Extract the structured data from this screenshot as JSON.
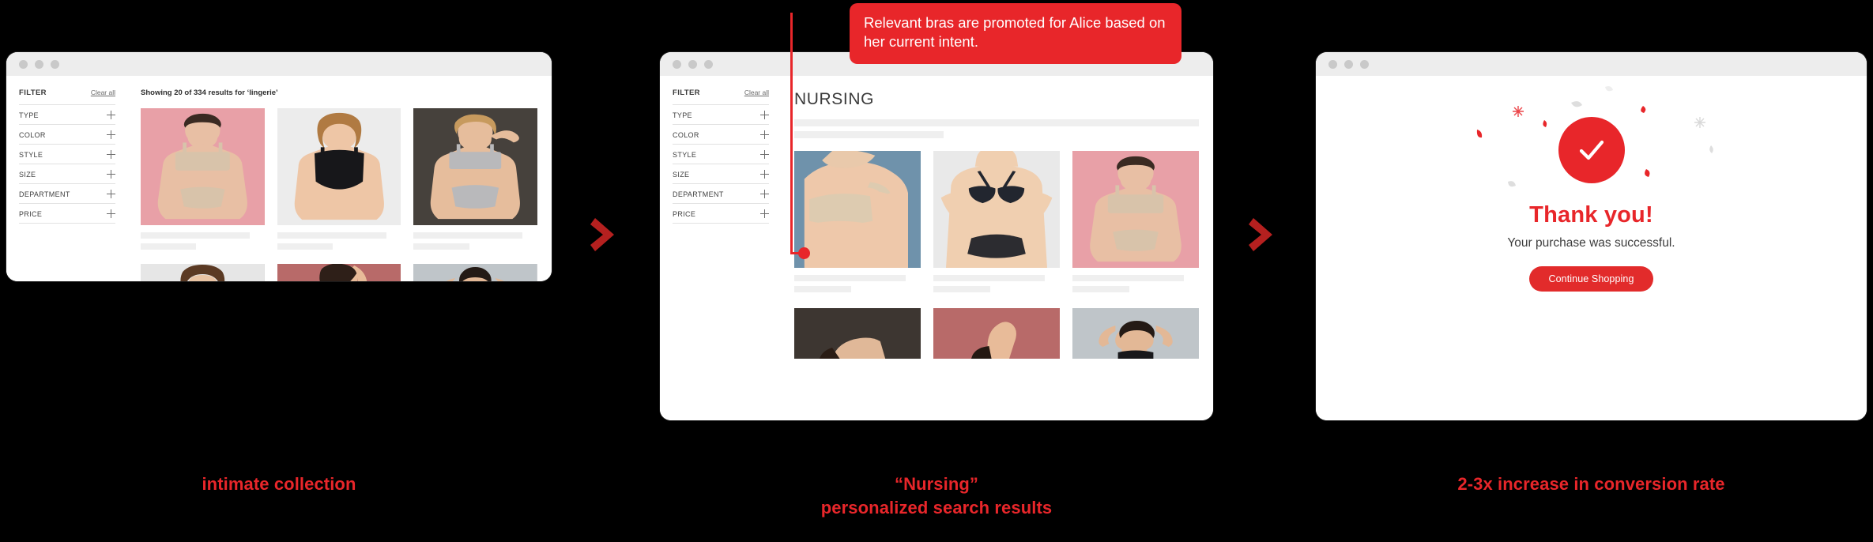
{
  "colors": {
    "accent_red": "#e8262a",
    "arrow_red": "#b5201f",
    "background": "#000000",
    "skeleton_gray": "#efefef",
    "titlebar_gray": "#ededed"
  },
  "callout": {
    "text": "Relevant bras are promoted for Alice based on her current intent."
  },
  "window_search": {
    "traffic_lights": [
      "close-dot",
      "minimize-dot",
      "maximize-dot"
    ],
    "sidebar": {
      "title": "FILTER",
      "clear_all": "Clear all",
      "facets": [
        {
          "label": "TYPE",
          "expander": "plus-icon"
        },
        {
          "label": "COLOR",
          "expander": "plus-icon"
        },
        {
          "label": "STYLE",
          "expander": "plus-icon"
        },
        {
          "label": "SIZE",
          "expander": "plus-icon"
        },
        {
          "label": "DEPARTMENT",
          "expander": "plus-icon"
        },
        {
          "label": "PRICE",
          "expander": "plus-icon"
        }
      ]
    },
    "results_count": "Showing 20 of 334 results for ‘lingerie’",
    "products_row1": [
      {
        "name": "product-pink-nude-set",
        "bg": "#e8a0a7",
        "skin": "#e8bfa4",
        "garment": "#d8c3aa",
        "hair": "#3a2a22"
      },
      {
        "name": "product-black-bodysuit",
        "bg": "#ececec",
        "skin": "#eec6a6",
        "garment": "#17171a",
        "hair": "#b07a42"
      },
      {
        "name": "product-gray-set",
        "bg": "#46413c",
        "skin": "#e6bd9c",
        "garment": "#b9b9bb",
        "hair": "#c79a5e"
      }
    ],
    "products_row2": [
      {
        "name": "product-white-black-dress",
        "bg": "#e6e6e6",
        "skin": "#eac4a4",
        "garment": "#1b1b1e",
        "hair": "#5b3a24"
      },
      {
        "name": "product-rose-bralette",
        "bg": "#b86a69",
        "skin": "#e8bb99",
        "garment": "#e6e0d4",
        "hair": "#2e1f18"
      },
      {
        "name": "product-gray-camisole",
        "bg": "#bfc5c9",
        "skin": "#e3b896",
        "garment": "#18181b",
        "hair": "#241a15"
      }
    ]
  },
  "window_category": {
    "traffic_lights": [
      "close-dot",
      "minimize-dot",
      "maximize-dot"
    ],
    "sidebar": {
      "title": "FILTER",
      "clear_all": "Clear all",
      "facets": [
        {
          "label": "TYPE",
          "expander": "plus-icon"
        },
        {
          "label": "COLOR",
          "expander": "plus-icon"
        },
        {
          "label": "STYLE",
          "expander": "plus-icon"
        },
        {
          "label": "SIZE",
          "expander": "plus-icon"
        },
        {
          "label": "DEPARTMENT",
          "expander": "plus-icon"
        },
        {
          "label": "PRICE",
          "expander": "plus-icon"
        }
      ]
    },
    "category_title": "NURSING",
    "products_row1": [
      {
        "name": "product-nursing-bra-blue",
        "bg": "#6f92ab",
        "skin": "#eec8aa",
        "garment": "#ddcbb0",
        "hair": "#e9c9ab"
      },
      {
        "name": "product-navy-lace-bra",
        "bg": "#e9e9e9",
        "skin": "#f0cfb0",
        "garment": "#22262f",
        "hair": "#e9cfb3"
      },
      {
        "name": "product-nude-set-pink-bg",
        "bg": "#e8a0a7",
        "skin": "#e8bfa4",
        "garment": "#d8c3aa",
        "hair": "#3a2a22"
      }
    ],
    "products_row2": [
      {
        "name": "product-dark-bg-model",
        "bg": "#3d3631",
        "skin": "#e0b898",
        "garment": "#2a2422",
        "hair": "#2a1c14"
      },
      {
        "name": "product-rose-bg-model",
        "bg": "#b86a69",
        "skin": "#e8bb99",
        "garment": "#1e1a18",
        "hair": "#241812"
      },
      {
        "name": "product-gray-bg-model",
        "bg": "#bfc5c9",
        "skin": "#e3b896",
        "garment": "#18181b",
        "hair": "#241a15"
      }
    ]
  },
  "window_thanks": {
    "traffic_lights": [
      "close-dot",
      "minimize-dot",
      "maximize-dot"
    ],
    "check_icon": "checkmark-icon",
    "title": "Thank you!",
    "subtitle": "Your purchase was successful.",
    "button_label": "Continue Shopping"
  },
  "arrows": {
    "first": "chevron-right-icon",
    "second": "chevron-right-icon"
  },
  "captions": {
    "left": "intimate collection",
    "middle": "“Nursing”\npersonalized search results",
    "right": "2-3x increase in conversion rate"
  }
}
